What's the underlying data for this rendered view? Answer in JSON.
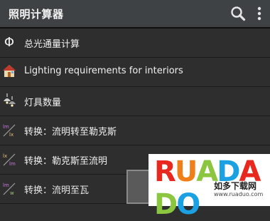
{
  "app_bar": {
    "title": "照明计算器",
    "background": "#3f4244",
    "actions": [
      {
        "name": "search-icon"
      },
      {
        "name": "overflow-menu-icon"
      }
    ]
  },
  "list": {
    "items": [
      {
        "icon": "phi-symbol-icon",
        "icon_text": "Φ",
        "label": "总光通量计算"
      },
      {
        "icon": "house-icon",
        "label": "Lighting requirements for interiors"
      },
      {
        "icon": "ceiling-lamp-icon",
        "label": "灯具数量"
      },
      {
        "icon": "lm-lx-conversion-icon",
        "icon_top": "lm",
        "icon_bottom": "lx",
        "label": "转换：流明转至勒克斯"
      },
      {
        "icon": "lx-lm-conversion-icon",
        "icon_top": "lx",
        "icon_bottom": "lm",
        "label": "转换：勒克斯至流明"
      },
      {
        "icon": "lm-w-conversion-icon",
        "icon_top": "lm",
        "icon_bottom": "w",
        "label": "转换：流明至瓦"
      }
    ]
  },
  "watermark": {
    "brand": "RUADADO",
    "subtitle": "如多下载网",
    "url": "www.ruaduo.com",
    "letter_colors": [
      "#e8281e",
      "#f07f1a",
      "#8cc63f",
      "#1ba1e2",
      "#e8281e",
      "#8cc63f",
      "#1ba1e2"
    ]
  }
}
